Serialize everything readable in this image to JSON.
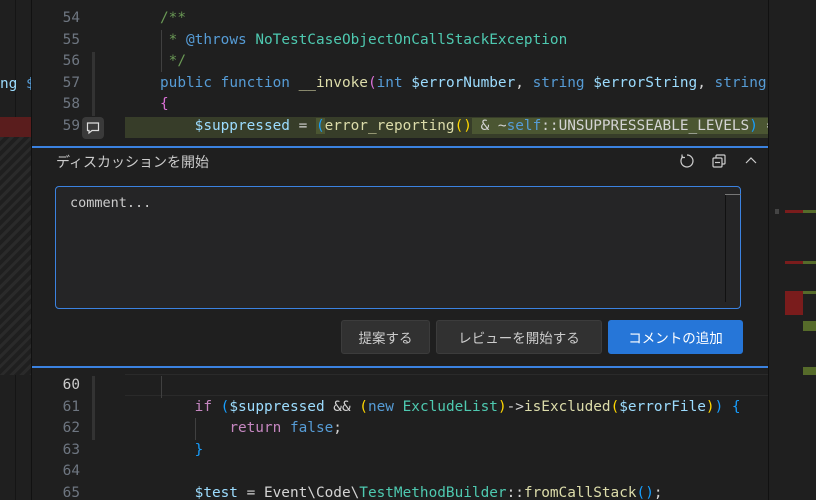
{
  "left_pane": {
    "fragment_keyword": "ng",
    "fragment_var": " $"
  },
  "editor_top": {
    "lines": [
      {
        "num": "54",
        "tokens": [
          [
            "c",
            "/**"
          ]
        ]
      },
      {
        "num": "55",
        "tokens": [
          [
            "c",
            " * "
          ],
          [
            "k",
            "@throws"
          ],
          [
            "x",
            " "
          ],
          [
            "t",
            "NoTestCaseObjectOnCallStackException"
          ]
        ]
      },
      {
        "num": "56",
        "tokens": [
          [
            "c",
            " */"
          ]
        ]
      },
      {
        "num": "57",
        "tokens": [
          [
            "k",
            "public"
          ],
          [
            "x",
            " "
          ],
          [
            "k",
            "function"
          ],
          [
            "x",
            " "
          ],
          [
            "f",
            "__invoke"
          ],
          [
            "m",
            "("
          ],
          [
            "k",
            "int"
          ],
          [
            "x",
            " "
          ],
          [
            "v",
            "$errorNumber"
          ],
          [
            "x",
            ", "
          ],
          [
            "k",
            "string"
          ],
          [
            "x",
            " "
          ],
          [
            "v",
            "$errorString"
          ],
          [
            "x",
            ", "
          ],
          [
            "k",
            "string"
          ],
          [
            "x",
            " "
          ],
          [
            "v",
            "$"
          ]
        ]
      },
      {
        "num": "58",
        "tokens": [
          [
            "m",
            "{"
          ]
        ]
      },
      {
        "num": "59",
        "tokens": [
          [
            "x",
            "    "
          ],
          [
            "v",
            "$suppressed"
          ],
          [
            "x",
            " = "
          ],
          [
            "b",
            "("
          ],
          [
            "f",
            "error_reporting"
          ],
          [
            "y",
            "()"
          ],
          [
            "x",
            " & ~"
          ],
          [
            "k",
            "self"
          ],
          [
            "x",
            "::UNSUPPRESSEABLE_LEVELS"
          ],
          [
            "b",
            ")"
          ],
          [
            "x",
            " =="
          ]
        ]
      }
    ]
  },
  "comment_widget": {
    "title": "ディスカッションを開始",
    "icons": [
      "refresh-icon",
      "collapse-all-icon",
      "chevron-up-icon"
    ],
    "input_value": "comment...",
    "buttons": {
      "suggest": "提案する",
      "start_review": "レビューを開始する",
      "add_comment": "コメントの追加"
    },
    "accent": "#3b82e0"
  },
  "editor_bottom": {
    "lines": [
      {
        "num": "60",
        "tokens": [],
        "active": true
      },
      {
        "num": "61",
        "tokens": [
          [
            "x",
            "    "
          ],
          [
            "p",
            "if"
          ],
          [
            "x",
            " "
          ],
          [
            "b",
            "("
          ],
          [
            "v",
            "$suppressed"
          ],
          [
            "x",
            " && "
          ],
          [
            "y",
            "("
          ],
          [
            "k",
            "new"
          ],
          [
            "x",
            " "
          ],
          [
            "t",
            "ExcludeList"
          ],
          [
            "y",
            ")"
          ],
          [
            "x",
            "->"
          ],
          [
            "f",
            "isExcluded"
          ],
          [
            "y",
            "("
          ],
          [
            "v",
            "$errorFile"
          ],
          [
            "y",
            ")"
          ],
          [
            "b",
            ")"
          ],
          [
            "x",
            " "
          ],
          [
            "b",
            "{"
          ]
        ]
      },
      {
        "num": "62",
        "tokens": [
          [
            "x",
            "        "
          ],
          [
            "p",
            "return"
          ],
          [
            "x",
            " "
          ],
          [
            "k",
            "false"
          ],
          [
            "x",
            ";"
          ]
        ]
      },
      {
        "num": "63",
        "tokens": [
          [
            "x",
            "    "
          ],
          [
            "b",
            "}"
          ]
        ]
      },
      {
        "num": "64",
        "tokens": []
      },
      {
        "num": "65",
        "tokens": [
          [
            "x",
            "    "
          ],
          [
            "v",
            "$test"
          ],
          [
            "x",
            " = Event\\Code\\"
          ],
          [
            "t",
            "TestMethodBuilder"
          ],
          [
            "x",
            "::"
          ],
          [
            "f",
            "fromCallStack"
          ],
          [
            "b",
            "()"
          ],
          [
            "x",
            ";"
          ]
        ]
      }
    ]
  },
  "colors": {
    "diff_inserted": "#373d29",
    "diff_removed": "#5a1d1d",
    "primary_button": "#2676d8"
  }
}
